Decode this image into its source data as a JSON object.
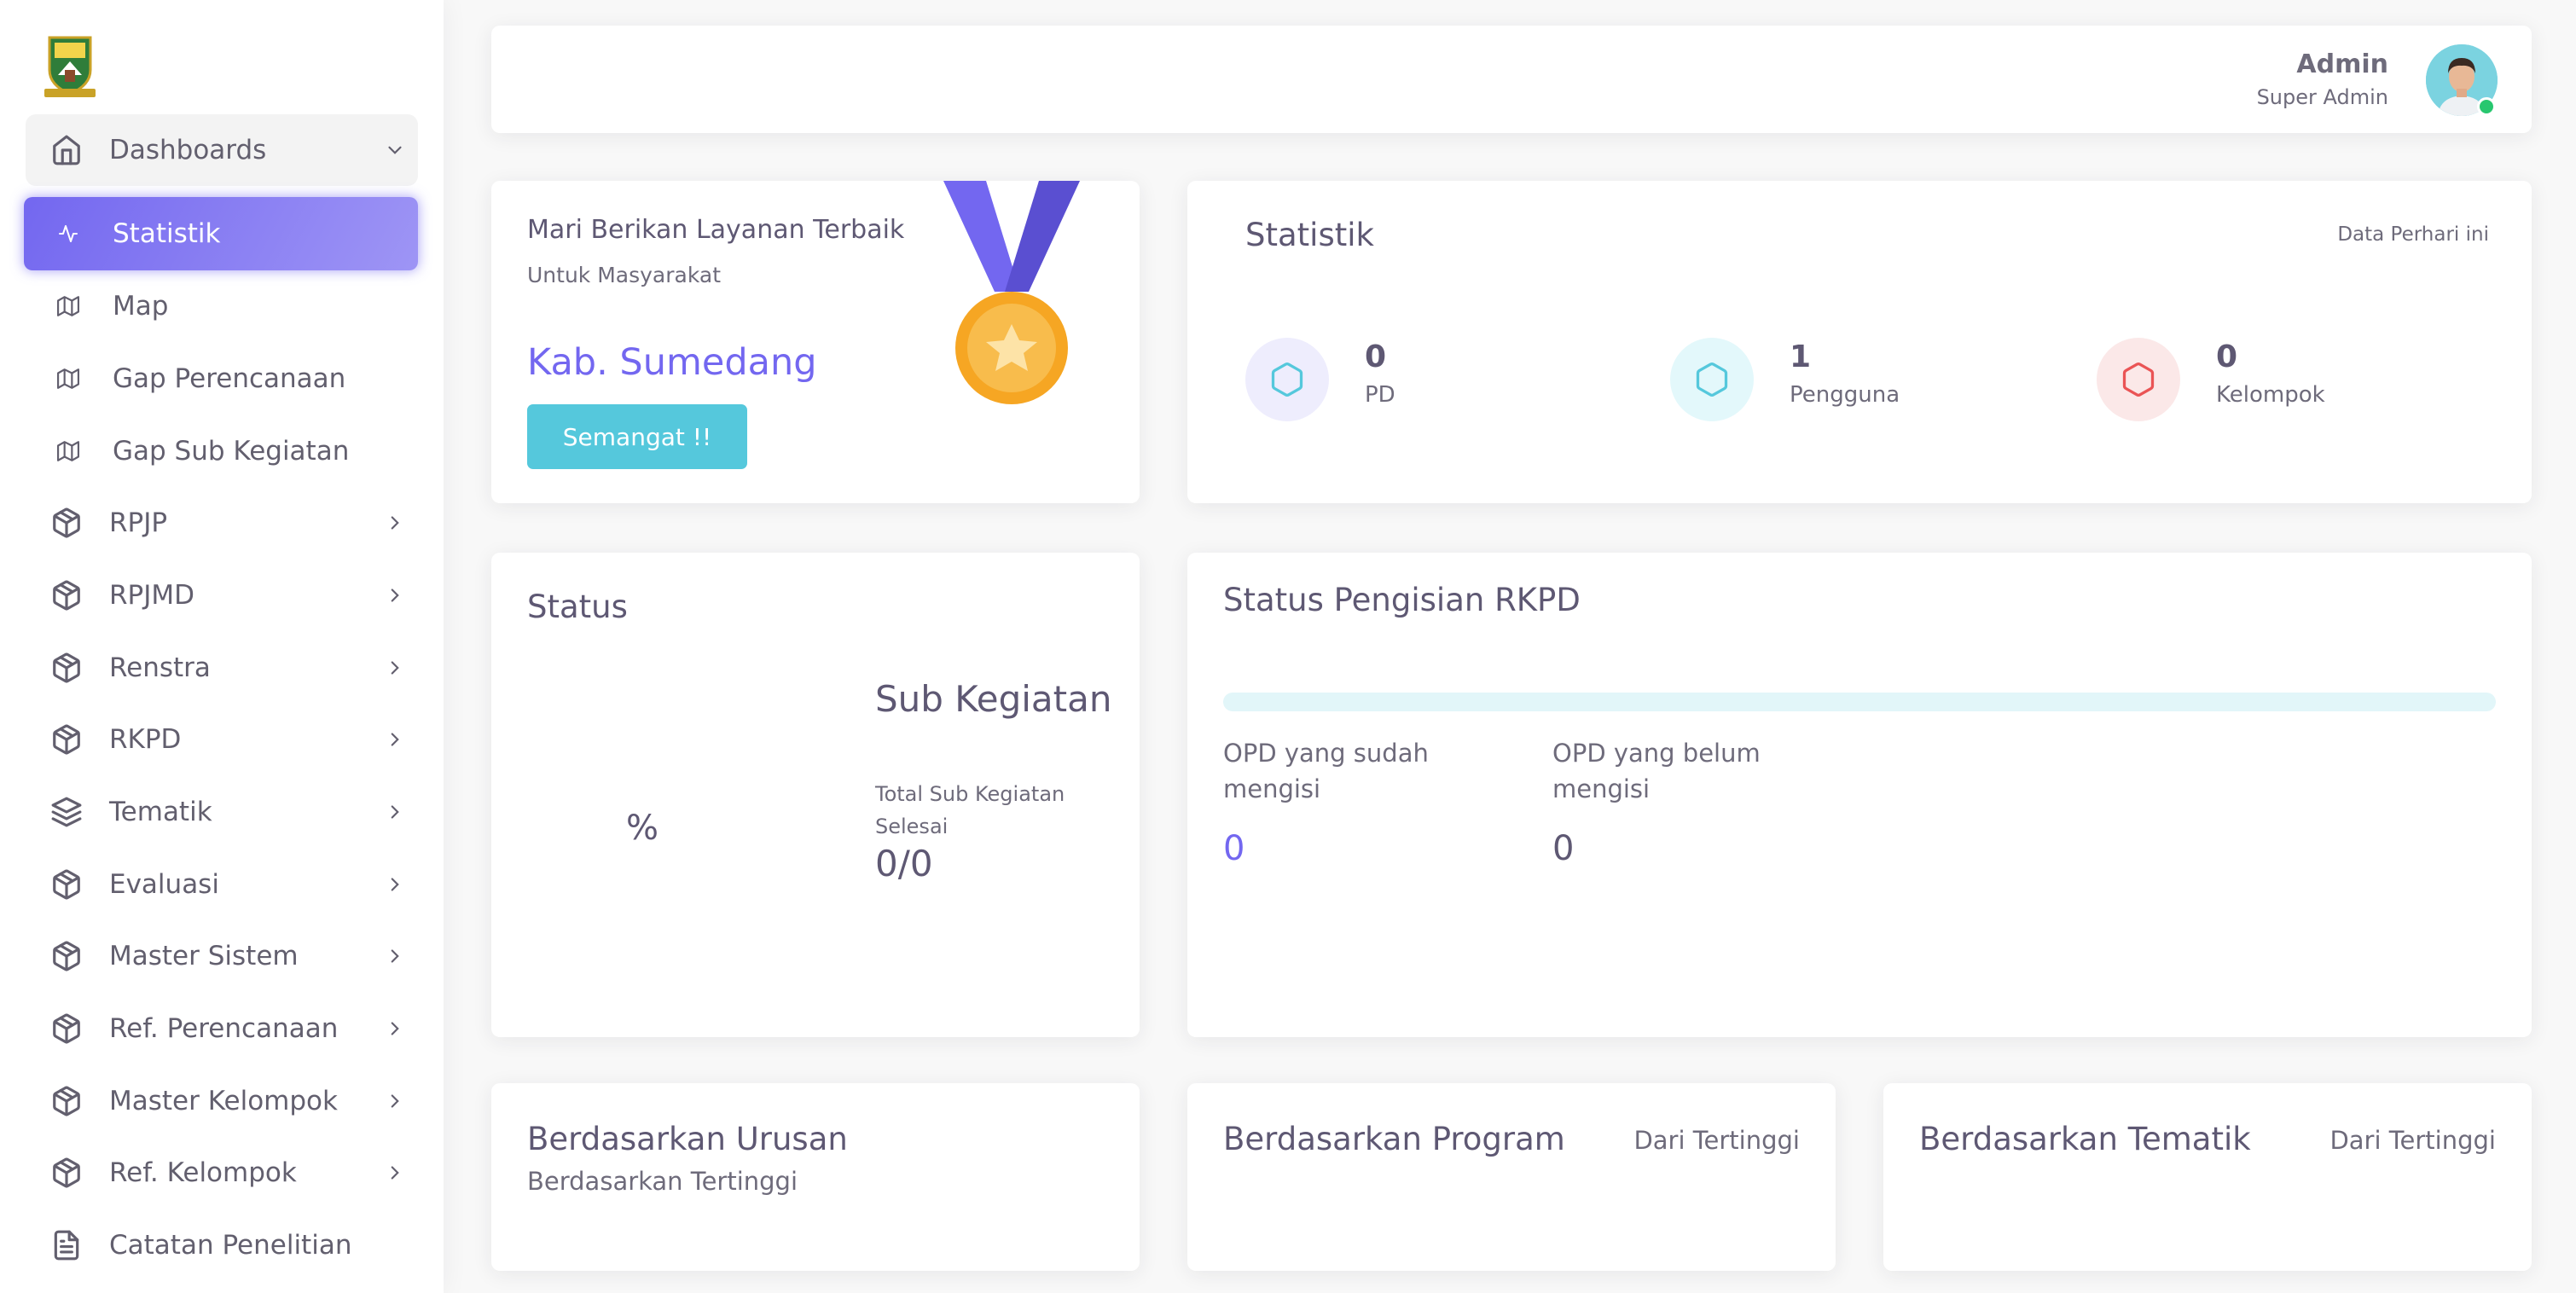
{
  "colors": {
    "primary": "#7367f0",
    "info": "#55c8dc",
    "danger": "#ea5455",
    "success": "#28c76f",
    "text": "#5e5873"
  },
  "sidebar": {
    "logo_icon": "coat-of-arms-icon",
    "dashboards": {
      "label": "Dashboards",
      "icon": "home-icon"
    },
    "active": {
      "label": "Statistik",
      "icon": "activity-icon"
    },
    "items": [
      {
        "label": "Map",
        "icon": "map-icon"
      },
      {
        "label": "Gap Perencanaan",
        "icon": "map-icon"
      },
      {
        "label": "Gap Sub Kegiatan",
        "icon": "map-icon"
      },
      {
        "label": "RPJP",
        "icon": "package-icon"
      },
      {
        "label": "RPJMD",
        "icon": "package-icon"
      },
      {
        "label": "Renstra",
        "icon": "package-icon"
      },
      {
        "label": "RKPD",
        "icon": "package-icon"
      },
      {
        "label": "Tematik",
        "icon": "layers-icon"
      },
      {
        "label": "Evaluasi",
        "icon": "package-icon"
      },
      {
        "label": "Master Sistem",
        "icon": "package-icon"
      },
      {
        "label": "Ref. Perencanaan",
        "icon": "package-icon"
      },
      {
        "label": "Master Kelompok",
        "icon": "package-icon"
      },
      {
        "label": "Ref. Kelompok",
        "icon": "package-icon"
      },
      {
        "label": "Catatan Penelitian",
        "icon": "file-text-icon"
      }
    ]
  },
  "user": {
    "name": "Admin",
    "role": "Super Admin"
  },
  "congrats": {
    "line1": "Mari Berikan Layanan Terbaik",
    "line2": "Untuk Masyarakat",
    "region": "Kab. Sumedang",
    "button": "Semangat !!"
  },
  "statistik": {
    "title": "Statistik",
    "subtitle": "Data Perhari ini",
    "items": [
      {
        "value": "0",
        "label": "PD",
        "color": "#7367f0"
      },
      {
        "value": "1",
        "label": "Pengguna",
        "color": "#00cfe8"
      },
      {
        "value": "0",
        "label": "Kelompok",
        "color": "#ea5455"
      }
    ]
  },
  "status": {
    "title": "Status",
    "percent": "%",
    "heading": "Sub Kegiatan",
    "caption": "Total Sub Kegiatan Selesai",
    "value": "0/0"
  },
  "rkpd": {
    "title": "Status Pengisian RKPD",
    "progress": 0,
    "sudah_label": "OPD yang sudah mengisi",
    "sudah_value": "0",
    "belum_label": "OPD yang belum mengisi",
    "belum_value": "0"
  },
  "bottom": {
    "urusan": {
      "title": "Berdasarkan Urusan",
      "subtitle": "Berdasarkan Tertinggi"
    },
    "program": {
      "title": "Berdasarkan Program",
      "right": "Dari Tertinggi"
    },
    "tematik": {
      "title": "Berdasarkan Tematik",
      "right": "Dari Tertinggi"
    }
  }
}
